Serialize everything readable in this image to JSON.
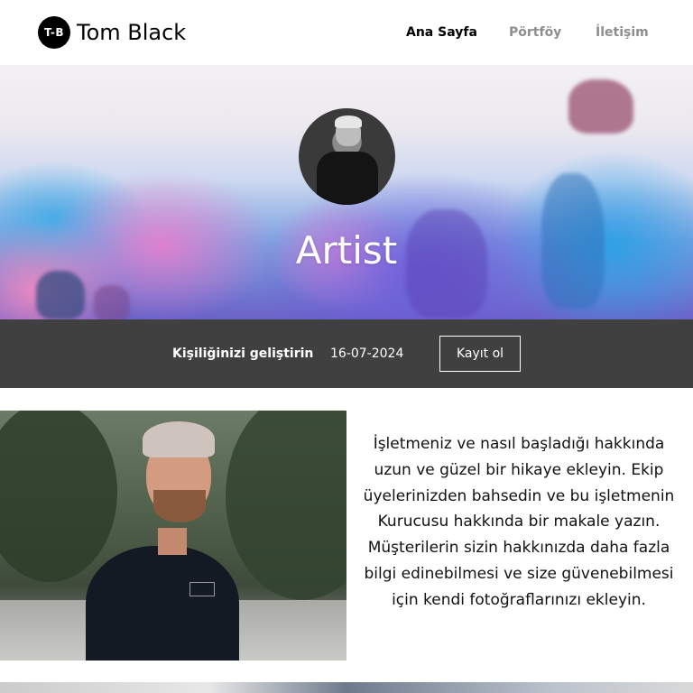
{
  "header": {
    "logo_badge": "T-B",
    "site_title": "Tom Black",
    "nav": [
      {
        "label": "Ana Sayfa",
        "active": true
      },
      {
        "label": "Pörtföy",
        "active": false
      },
      {
        "label": "İletişim",
        "active": false
      }
    ]
  },
  "hero": {
    "title": "Artist"
  },
  "info_bar": {
    "label": "Kişiliğinizi geliştirin",
    "date": "16-07-2024",
    "button_label": "Kayıt ol"
  },
  "about": {
    "text": "İşletmeniz ve nasıl başladığı hakkında uzun ve güzel bir hikaye ekleyin. Ekip üyelerinizden bahsedin ve bu işletmenin Kurucusu hakkında bir makale yazın. Müşterilerin sizin hakkınızda daha fazla bilgi edinebilmesi ve size güvenebilmesi için kendi fotoğraflarınızı ekleyin."
  },
  "colors": {
    "bar_background": "#404040",
    "text_active": "#000000",
    "text_muted": "#8e8e8e"
  }
}
